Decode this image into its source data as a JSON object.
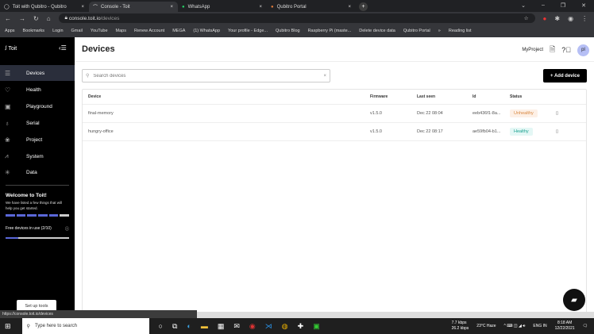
{
  "browser": {
    "tabs": [
      {
        "label": "Toit with Qubitro - Qubitro"
      },
      {
        "label": "Console - Toit"
      },
      {
        "label": "WhatsApp"
      },
      {
        "label": "Qubitro Portal"
      }
    ],
    "url_host": "console.toit.io",
    "url_path": "/devices",
    "bookmarks": [
      "Apps",
      "Bookmarks",
      "Login",
      "Gmail",
      "YouTube",
      "Maps",
      "Renew Account",
      "MEGA",
      "(1) WhatsApp",
      "Your profile - Edge...",
      "Qubitro Blog",
      "Raspberry Pi (maste...",
      "Delete device data",
      "Qubitro Portal"
    ],
    "reading_list": "Reading list",
    "status_url": "https://console.toit.io/devices"
  },
  "sidebar": {
    "logo": "Toit",
    "items": [
      {
        "label": "Devices",
        "icon": "devices-icon"
      },
      {
        "label": "Health",
        "icon": "health-icon"
      },
      {
        "label": "Playground",
        "icon": "playground-icon"
      },
      {
        "label": "Serial",
        "icon": "serial-icon"
      },
      {
        "label": "Project",
        "icon": "project-icon"
      },
      {
        "label": "System",
        "icon": "system-icon"
      },
      {
        "label": "Data",
        "icon": "data-icon"
      }
    ],
    "welcome_title": "Welcome to Toit!",
    "welcome_text": "We have listed a few things that will help you get started.",
    "steps_done": 5,
    "steps_total": 6,
    "free_devices_label": "Free devices in use (2/10)",
    "free_devices_fraction": 0.2,
    "setup_button": "Set up tools"
  },
  "header": {
    "title": "Devices",
    "project": "MyProject",
    "avatar": "pl"
  },
  "search": {
    "placeholder": "Search devices",
    "value": ""
  },
  "add_button": "+ Add device",
  "table": {
    "columns": [
      "Device",
      "Firmware",
      "Last seen",
      "Id",
      "Status"
    ],
    "rows": [
      {
        "device": "final-memory",
        "firmware": "v1.5.0",
        "last_seen": "Dec 22 08:04",
        "id": "eeb436f1-8a...",
        "status": "Unhealthy"
      },
      {
        "device": "hungry-office",
        "firmware": "v1.5.0",
        "last_seen": "Dec 22 08:17",
        "id": "ae59fb04-b1...",
        "status": "Healthy"
      }
    ]
  },
  "taskbar": {
    "search_placeholder": "Type here to search",
    "net_down": "7.7 kbps",
    "net_up": "26.2 kbps",
    "weather": "23°C Haze",
    "lang": "ENG IN",
    "time": "8:18 AM",
    "date": "12/22/2021"
  },
  "colors": {
    "accent": "#5a67d8",
    "unhealthy": "#d88840",
    "healthy": "#17a08e"
  }
}
